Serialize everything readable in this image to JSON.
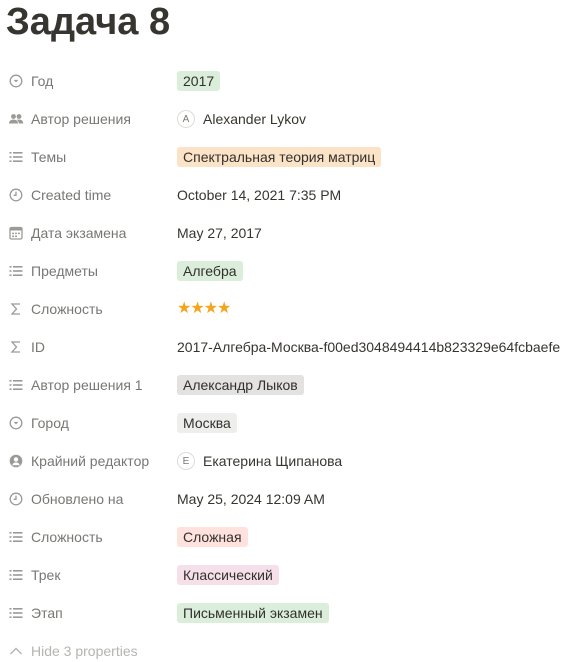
{
  "page": {
    "title": "Задача 8"
  },
  "colors": {
    "label": "#787774",
    "text": "#37352f",
    "star": "#f4a51c",
    "tag_green": "#dbeddb",
    "tag_orange": "#fae3c6",
    "tag_gray": "#e3e2e0",
    "tag_red": "#ffe2dd",
    "tag_pink": "#f5e0e9"
  },
  "properties": [
    {
      "icon": "select-icon",
      "label": "Год",
      "value": "2017",
      "kind": "tag",
      "color": "green"
    },
    {
      "icon": "people-icon",
      "label": "Автор решения",
      "value": "Alexander Lykov",
      "avatar": "A",
      "kind": "person"
    },
    {
      "icon": "list-icon",
      "label": "Темы",
      "value": "Спектральная теория матриц",
      "kind": "tag",
      "color": "orange"
    },
    {
      "icon": "clock-icon",
      "label": "Created time",
      "value": "October 14, 2021 7:35 PM",
      "kind": "text"
    },
    {
      "icon": "calendar-icon",
      "label": "Дата экзамена",
      "value": "May 27, 2017",
      "kind": "text"
    },
    {
      "icon": "list-icon",
      "label": "Предметы",
      "value": "Алгебра",
      "kind": "tag",
      "color": "green"
    },
    {
      "icon": "sigma-icon",
      "label": "Сложность",
      "value": "★★★★",
      "rating": 4,
      "kind": "stars"
    },
    {
      "icon": "sigma-icon",
      "label": "ID",
      "value": "2017-Алгебра-Москва-f00ed3048494414b823329e64fcbaefe",
      "kind": "text"
    },
    {
      "icon": "list-icon",
      "label": "Автор решения 1",
      "value": "Александр Лыков",
      "kind": "tag",
      "color": "gray"
    },
    {
      "icon": "select-icon",
      "label": "Город",
      "value": "Москва",
      "kind": "tag",
      "color": "gray2"
    },
    {
      "icon": "person-circle-icon",
      "label": "Крайний редактор",
      "value": "Екатерина Щипанова",
      "avatar": "E",
      "kind": "person"
    },
    {
      "icon": "clock-icon",
      "label": "Обновлено на",
      "value": "May 25, 2024 12:09 AM",
      "kind": "text"
    },
    {
      "icon": "list-icon",
      "label": "Сложность",
      "value": "Сложная",
      "kind": "tag",
      "color": "red"
    },
    {
      "icon": "list-icon",
      "label": "Трек",
      "value": "Классический",
      "kind": "tag",
      "color": "pink"
    },
    {
      "icon": "list-icon",
      "label": "Этап",
      "value": "Письменный экзамен",
      "kind": "tag",
      "color": "green"
    }
  ],
  "footer": {
    "hide_label": "Hide 3 properties"
  }
}
